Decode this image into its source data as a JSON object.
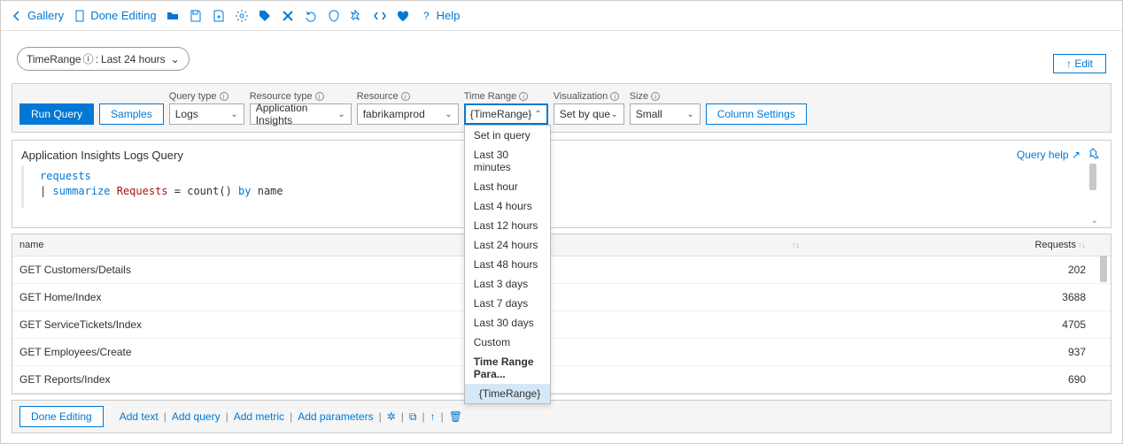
{
  "toolbar": {
    "gallery": "Gallery",
    "done_editing": "Done Editing",
    "help": "Help"
  },
  "parameter_pill": {
    "name": "TimeRange",
    "value": "Last 24 hours"
  },
  "edit_button": "↑ Edit",
  "controls": {
    "run_query": "Run Query",
    "samples": "Samples",
    "query_type": {
      "label": "Query type",
      "value": "Logs"
    },
    "resource_type": {
      "label": "Resource type",
      "value": "Application Insights"
    },
    "resource": {
      "label": "Resource",
      "value": "fabrikamprod"
    },
    "time_range": {
      "label": "Time Range",
      "value": "{TimeRange}"
    },
    "visualization": {
      "label": "Visualization",
      "value": "Set by query"
    },
    "size": {
      "label": "Size",
      "value": "Small"
    },
    "column_settings": "Column Settings"
  },
  "time_range_options": [
    "Set in query",
    "Last 30 minutes",
    "Last hour",
    "Last 4 hours",
    "Last 12 hours",
    "Last 24 hours",
    "Last 48 hours",
    "Last 3 days",
    "Last 7 days",
    "Last 30 days",
    "Custom"
  ],
  "time_range_param_header": "Time Range Para...",
  "time_range_selected": "{TimeRange}",
  "query_section": {
    "title": "Application Insights Logs Query",
    "help": "Query help",
    "code_line1": "requests",
    "code_line2_pipe": "|",
    "code_line2_summarize": "summarize",
    "code_line2_field": "Requests",
    "code_line2_eq": "= count()",
    "code_line2_by": "by",
    "code_line2_name": "name"
  },
  "table": {
    "col_name": "name",
    "col_requests": "Requests",
    "rows": [
      {
        "name": "GET Customers/Details",
        "requests": "202"
      },
      {
        "name": "GET Home/Index",
        "requests": "3688"
      },
      {
        "name": "GET ServiceTickets/Index",
        "requests": "4705"
      },
      {
        "name": "GET Employees/Create",
        "requests": "937"
      },
      {
        "name": "GET Reports/Index",
        "requests": "690"
      }
    ]
  },
  "footer": {
    "done_editing": "Done Editing",
    "add_text": "Add text",
    "add_query": "Add query",
    "add_metric": "Add metric",
    "add_parameters": "Add parameters"
  }
}
